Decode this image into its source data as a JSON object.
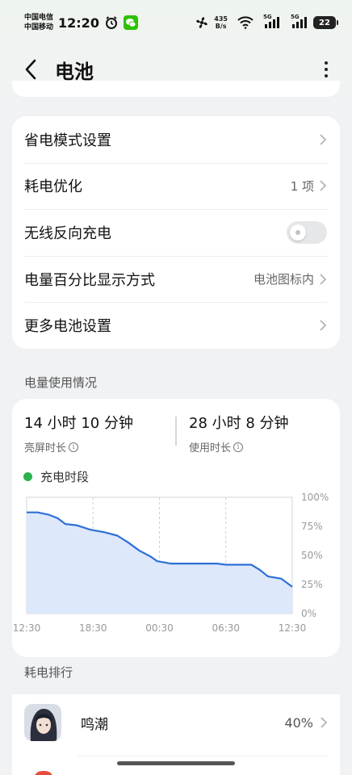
{
  "status_bar": {
    "carrier_1": "中国电信",
    "carrier_2": "中国移动",
    "time": "12:20",
    "net_speed_value": "435",
    "net_speed_unit": "B/s",
    "signal_1_label": "5G",
    "signal_2_label": "5G",
    "battery_level": "22",
    "icons": [
      "alarm-icon",
      "wechat-icon",
      "fan-icon",
      "wifi-icon",
      "signal-icon",
      "battery-icon"
    ]
  },
  "header": {
    "title": "电池"
  },
  "settings": [
    {
      "label": "省电模式设置",
      "value": "",
      "control": "chevron"
    },
    {
      "label": "耗电优化",
      "value": "1 项",
      "control": "chevron"
    },
    {
      "label": "无线反向充电",
      "value": "",
      "control": "toggle",
      "enabled": false
    },
    {
      "label": "电量百分比显示方式",
      "value": "电池图标内",
      "control": "chevron"
    },
    {
      "label": "更多电池设置",
      "value": "",
      "control": "chevron"
    }
  ],
  "usage": {
    "section_title": "电量使用情况",
    "screen_on_value": "14 小时 10 分钟",
    "screen_on_label": "亮屏时长",
    "usage_value": "28 小时 8 分钟",
    "usage_label": "使用时长",
    "legend_label": "充电时段",
    "colors": {
      "line": "#2f6fd6",
      "fill": "#dde8fb",
      "legend": "#2ab34f"
    }
  },
  "chart_data": {
    "type": "area",
    "y_ticks": [
      "100%",
      "75%",
      "50%",
      "25%",
      "0%"
    ],
    "ylim": [
      0,
      100
    ],
    "x_ticks": [
      "12:30",
      "18:30",
      "00:30",
      "06:30",
      "12:30"
    ],
    "x_hours": [
      0,
      6,
      12,
      18,
      24
    ],
    "series": [
      {
        "x": [
          0,
          1,
          2,
          2.8,
          3.5,
          4.5,
          5.8,
          7,
          8.2,
          9.2,
          10.2,
          11.2,
          11.8,
          12.4,
          13,
          14.5,
          16,
          17.2,
          18,
          19,
          20.3,
          21,
          21.8,
          23,
          24
        ],
        "y": [
          87,
          87,
          85,
          82,
          77,
          76,
          72,
          70,
          67,
          61,
          54,
          49,
          45,
          44,
          43,
          43,
          43,
          43,
          42,
          42,
          42,
          38,
          32,
          30,
          23
        ]
      }
    ]
  },
  "ranking": {
    "section_title": "耗电排行",
    "apps": [
      {
        "name": "鸣潮",
        "percent": "40%"
      }
    ]
  }
}
